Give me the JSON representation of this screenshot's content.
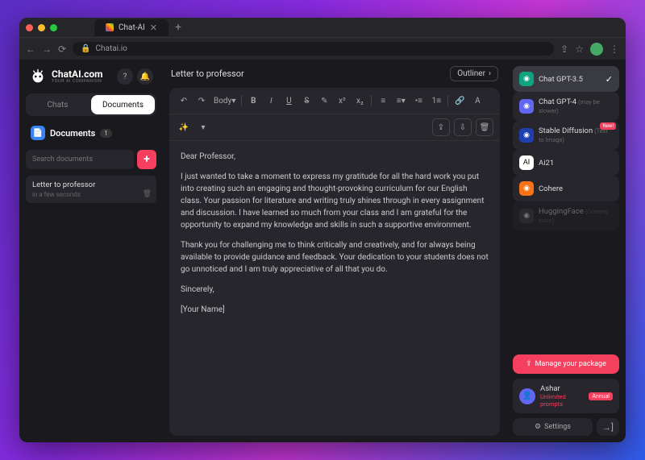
{
  "browser": {
    "tab_title": "Chat-AI",
    "url": "Chatai.io"
  },
  "brand": {
    "name": "ChatAI.com",
    "tagline": "YOUR AI COMPANION"
  },
  "tabs": {
    "chats": "Chats",
    "documents": "Documents"
  },
  "docs": {
    "section": "Documents",
    "count": "1",
    "search_placeholder": "Search documents",
    "item": {
      "title": "Letter to professor",
      "subtitle": "in a few seconds"
    }
  },
  "editor": {
    "title": "Letter to professor",
    "outliner": "Outliner",
    "body_dropdown": "Body",
    "paragraphs": [
      "Dear Professor,",
      "I just wanted to take a moment to express my gratitude for all the hard work you put into creating such an engaging and thought-provoking curriculum for our English class. Your passion for literature and writing truly shines through in every assignment and discussion. I have learned so much from your class and I am grateful for the opportunity to expand my knowledge and skills in such a supportive environment.",
      "Thank you for challenging me to think critically and creatively, and for always being available to provide guidance and feedback. Your dedication to your students does not go unnoticed and I am truly appreciative of all that you do.",
      "Sincerely,",
      "[Your Name]"
    ]
  },
  "models": [
    {
      "name": "Chat GPT-3.5",
      "sub": "",
      "color": "#10a37f",
      "selected": true
    },
    {
      "name": "Chat GPT-4",
      "sub": "(may be slower)",
      "color": "#6366f1",
      "selected": false
    },
    {
      "name": "Stable Diffusion",
      "sub": "(Text to Image)",
      "color": "#1e40af",
      "selected": false,
      "new": true
    },
    {
      "name": "Ai21",
      "sub": "",
      "color": "#ffffff",
      "selected": false
    },
    {
      "name": "Cohere",
      "sub": "",
      "color": "#f97316",
      "selected": false
    },
    {
      "name": "HuggingFace",
      "sub": "(Coming soon)",
      "color": "#444",
      "selected": false,
      "disabled": true
    }
  ],
  "labels": {
    "new_badge": "New!",
    "manage": "Manage your package",
    "settings": "Settings"
  },
  "user": {
    "name": "Ashar",
    "plan": "Unlimited prompts",
    "badge": "Annual"
  }
}
